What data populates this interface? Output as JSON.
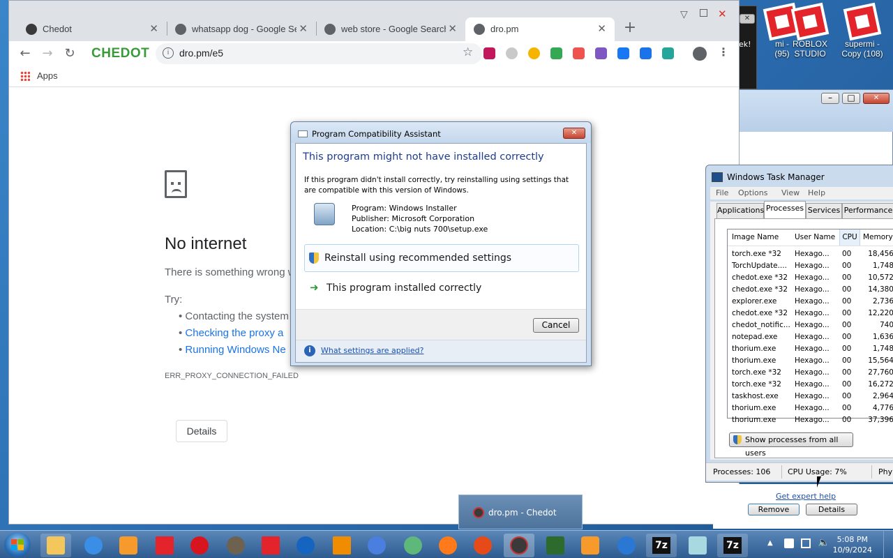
{
  "desktop": {
    "icons": [
      {
        "label_line1": "mi -",
        "label_line2": "(95)"
      },
      {
        "label_line1": "ROBLOX",
        "label_line2": "STUDIO"
      },
      {
        "label_line1": "supermi -",
        "label_line2": "Copy (108)"
      }
    ],
    "bg_window_text": "ek!"
  },
  "browser": {
    "tabs": [
      {
        "title": "Chedot"
      },
      {
        "title": "whatsapp dog - Google Sea"
      },
      {
        "title": "web store - Google Search"
      },
      {
        "title": "dro.pm"
      }
    ],
    "brand": "CHEDOT",
    "url": "dro.pm/e5",
    "bookmarks": {
      "apps_label": "Apps"
    },
    "page": {
      "heading": "No internet",
      "description": "There is something wrong w",
      "try_label": "Try:",
      "suggestions": [
        "Contacting the system",
        "Checking the proxy a",
        "Running Windows Ne"
      ],
      "error_code": "ERR_PROXY_CONNECTION_FAILED",
      "details_button": "Details"
    }
  },
  "dialog": {
    "title": "Program Compatibility Assistant",
    "heading": "This program might not have installed correctly",
    "message_line1": "If this program didn't install correctly, try reinstalling using settings that",
    "message_line2": "are compatible with this version of Windows.",
    "program": "Program: Windows Installer",
    "publisher": "Publisher: Microsoft Corporation",
    "location": "Location: C:\\big nuts 700\\setup.exe",
    "option_reinstall": "Reinstall using recommended settings",
    "option_ok": "This program installed correctly",
    "cancel": "Cancel",
    "help_link": "What settings are applied?"
  },
  "task_manager": {
    "title": "Windows Task Manager",
    "menu": [
      "File",
      "Options",
      "View",
      "Help"
    ],
    "tabs": [
      "Applications",
      "Processes",
      "Services",
      "Performance"
    ],
    "columns": [
      "Image Name",
      "User Name",
      "CPU",
      "Memory ("
    ],
    "rows": [
      [
        "torch.exe *32",
        "Hexago...",
        "00",
        "18,456"
      ],
      [
        "TorchUpdate....",
        "Hexago...",
        "00",
        "1,748"
      ],
      [
        "chedot.exe *32",
        "Hexago...",
        "00",
        "10,572"
      ],
      [
        "chedot.exe *32",
        "Hexago...",
        "00",
        "14,380"
      ],
      [
        "explorer.exe",
        "Hexago...",
        "00",
        "2,736"
      ],
      [
        "chedot.exe *32",
        "Hexago...",
        "00",
        "12,220"
      ],
      [
        "chedot_notific...",
        "Hexago...",
        "00",
        "740"
      ],
      [
        "notepad.exe",
        "Hexago...",
        "00",
        "1,636"
      ],
      [
        "thorium.exe",
        "Hexago...",
        "00",
        "1,748"
      ],
      [
        "thorium.exe",
        "Hexago...",
        "00",
        "15,564"
      ],
      [
        "torch.exe *32",
        "Hexago...",
        "00",
        "27,760"
      ],
      [
        "torch.exe *32",
        "Hexago...",
        "00",
        "16,272"
      ],
      [
        "taskhost.exe",
        "Hexago...",
        "00",
        "2,964"
      ],
      [
        "thorium.exe",
        "Hexago...",
        "00",
        "4,776"
      ],
      [
        "thorium.exe",
        "Hexago...",
        "00",
        "37,396"
      ]
    ],
    "show_all_button": "Show processes from all users",
    "status_processes": "Processes: 106",
    "status_cpu": "CPU Usage: 7%",
    "status_phys": "Phy"
  },
  "under_tm": {
    "help_link": "Get expert help",
    "remove_button": "Remove",
    "details_button": "Details"
  },
  "taskbar": {
    "thumbnail_label": "dro.pm - Chedot",
    "time": "5:08 PM",
    "date": "10/9/2024",
    "sevenzip_label": "7z"
  }
}
